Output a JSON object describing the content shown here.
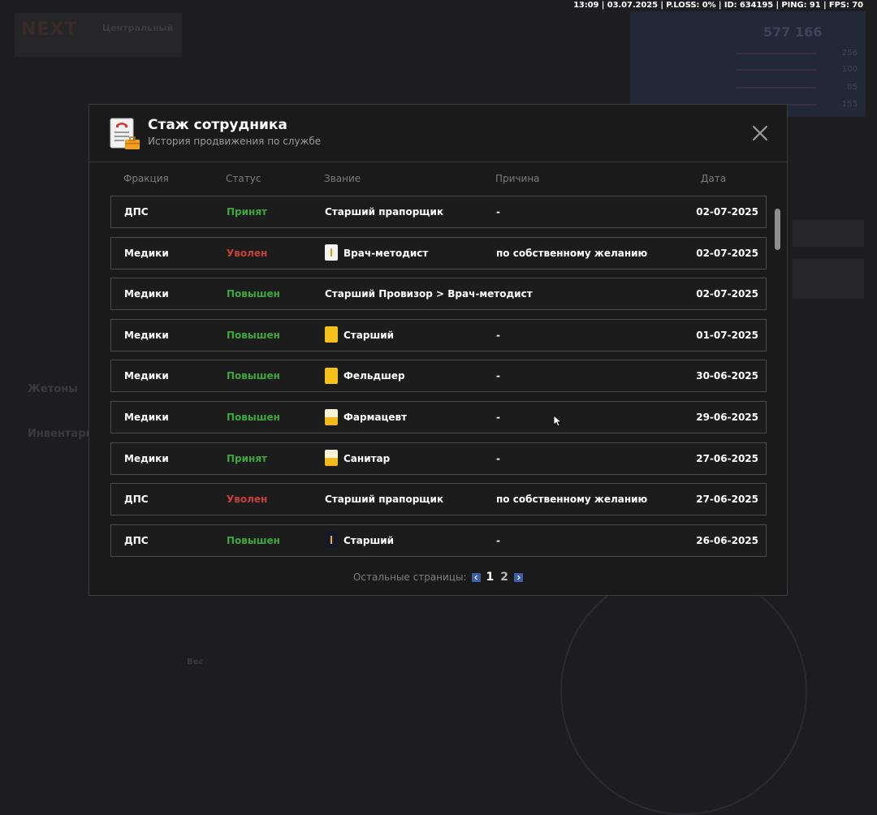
{
  "status_line": "13:09 | 03.07.2025 | P.LOSS: 0% | ID: 634195 | PING: 91 | FPS: 70",
  "background": {
    "logo_mark": "NEXT",
    "logo_text_1": "Центральный",
    "logo_text_2": "",
    "money": "577 166",
    "stats": [
      "256",
      "100",
      "85",
      "155"
    ],
    "label_tokens": "Жетоны",
    "label_inventory": "Инвентарь",
    "label_weight": "Вес"
  },
  "modal": {
    "title": "Стаж сотрудника",
    "subtitle": "История продвижения по службе",
    "icon": "document-briefcase-icon",
    "close_icon": "close-icon",
    "columns": {
      "faction": "Фракция",
      "status": "Статус",
      "rank": "Звание",
      "reason": "Причина",
      "date": "Дата"
    },
    "rows": [
      {
        "faction": "ДПС",
        "status": "Принят",
        "status_type": "green",
        "rank": "Старший прапорщик",
        "rank_icon": "none",
        "reason": "-",
        "date": "02-07-2025"
      },
      {
        "faction": "Медики",
        "status": "Уволен",
        "status_type": "red",
        "rank": "Врач-методист",
        "rank_icon": "white-dot",
        "reason": "по собственному желанию",
        "date": "02-07-2025"
      },
      {
        "faction": "Медики",
        "status": "Повышен",
        "status_type": "green",
        "rank": "Старший Провизор > Врач-методист",
        "rank_icon": "none",
        "reason": "",
        "date": "02-07-2025"
      },
      {
        "faction": "Медики",
        "status": "Повышен",
        "status_type": "green",
        "rank": "Старший",
        "rank_icon": "yellow",
        "reason": "-",
        "date": "01-07-2025"
      },
      {
        "faction": "Медики",
        "status": "Повышен",
        "status_type": "green",
        "rank": "Фельдшер",
        "rank_icon": "yellow",
        "reason": "-",
        "date": "30-06-2025"
      },
      {
        "faction": "Медики",
        "status": "Повышен",
        "status_type": "green",
        "rank": "Фармацевт",
        "rank_icon": "split",
        "reason": "-",
        "date": "29-06-2025"
      },
      {
        "faction": "Медики",
        "status": "Принят",
        "status_type": "green",
        "rank": "Санитар",
        "rank_icon": "split",
        "reason": "-",
        "date": "27-06-2025"
      },
      {
        "faction": "ДПС",
        "status": "Уволен",
        "status_type": "red",
        "rank": "Старший прапорщик",
        "rank_icon": "none",
        "reason": "по собственному желанию",
        "date": "27-06-2025"
      },
      {
        "faction": "ДПС",
        "status": "Повышен",
        "status_type": "green",
        "rank": "Старший",
        "rank_icon": "navy",
        "reason": "-",
        "date": "26-06-2025"
      }
    ],
    "pager": {
      "label": "Остальные страницы:",
      "pages": [
        "1",
        "2"
      ],
      "current": "1",
      "prev_icon": "chevron-left-icon",
      "next_icon": "chevron-right-icon"
    }
  },
  "colors": {
    "status_green": "#3fa63f",
    "status_red": "#c4413a",
    "pager_arrow": "#3c5fa6"
  }
}
